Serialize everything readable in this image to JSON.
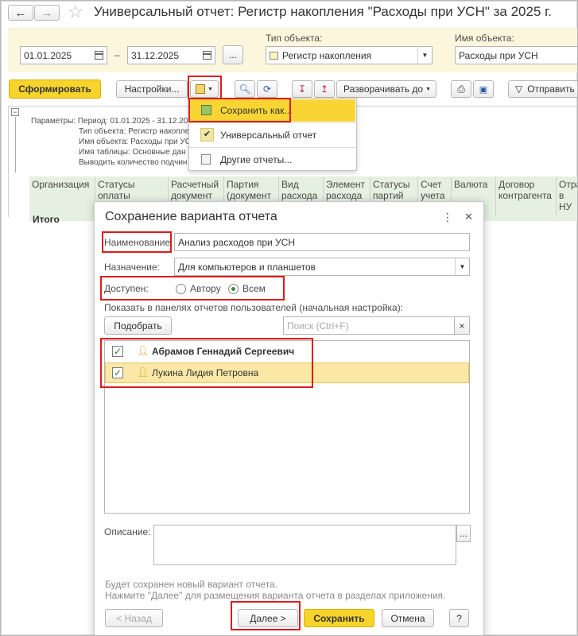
{
  "window": {
    "title": "Универсальный отчет: Регистр накопления \"Расходы при УСН\" за 2025 г."
  },
  "filters": {
    "date_from": "01.01.2025",
    "date_to": "31.12.2025",
    "dash": "–",
    "more_button": "...",
    "object_type_label": "Тип объекта:",
    "object_type_value": "Регистр накопления",
    "object_name_label": "Имя объекта:",
    "object_name_value": "Расходы при УСН"
  },
  "toolbar": {
    "generate": "Сформировать",
    "settings": "Настройки...",
    "expand_to": "Разворачивать до",
    "send": "Отправить"
  },
  "save_menu": {
    "items": [
      "Сохранить как...",
      "Универсальный отчет",
      "Другие отчеты..."
    ]
  },
  "params": {
    "lines": [
      "Параметры: Период: 01.01.2025 - 31.12.202",
      "Тип объекта: Регистр накоплен",
      "Имя объекта: Расходы при УС",
      "Имя таблицы: Основные дан",
      "Выводить количество подчин"
    ]
  },
  "table": {
    "headers": [
      "Организация",
      "Статусы оплаты",
      "Расчетный документ",
      "Партия (документ",
      "Вид расхода",
      "Элемент расхода",
      "Статусы партий",
      "Счет учета",
      "Валюта",
      "Договор контрагента",
      "Отра в НУ"
    ],
    "total": "Итого"
  },
  "dialog": {
    "title": "Сохранение варианта отчета",
    "name_label": "Наименование:",
    "name_value": "Анализ расходов при УСН",
    "purpose_label": "Назначение:",
    "purpose_value": "Для компьютеров и планшетов",
    "available_label": "Доступен:",
    "radio_author": "Автору",
    "radio_all": "Всем",
    "show_label": "Показать в панелях отчетов пользователей (начальная настройка):",
    "pick_button": "Подобрать",
    "search_placeholder": "Поиск (Ctrl+F)",
    "clear": "×",
    "users": [
      {
        "name": "Абрамов Геннадий Сергеевич",
        "checked": true,
        "bold": true
      },
      {
        "name": "Лукина Лидия Петровна",
        "checked": true,
        "bold": false
      }
    ],
    "desc_label": "Описание:",
    "desc_more": "...",
    "info_line1": "Будет сохранен новый вариант отчета.",
    "info_line2": "Нажмите \"Далее\" для размещения варианта отчета в разделах приложения.",
    "back_button": "< Назад",
    "next_button": "Далее >",
    "save_button": "Сохранить",
    "cancel_button": "Отмена",
    "help_button": "?",
    "menu_dots": "⋮",
    "close": "✕"
  },
  "colors": {
    "accent_yellow": "#f7d42c",
    "highlight_red": "#e01b1b",
    "header_green": "#e5f0e0",
    "selected_row": "#fbe8a6"
  }
}
